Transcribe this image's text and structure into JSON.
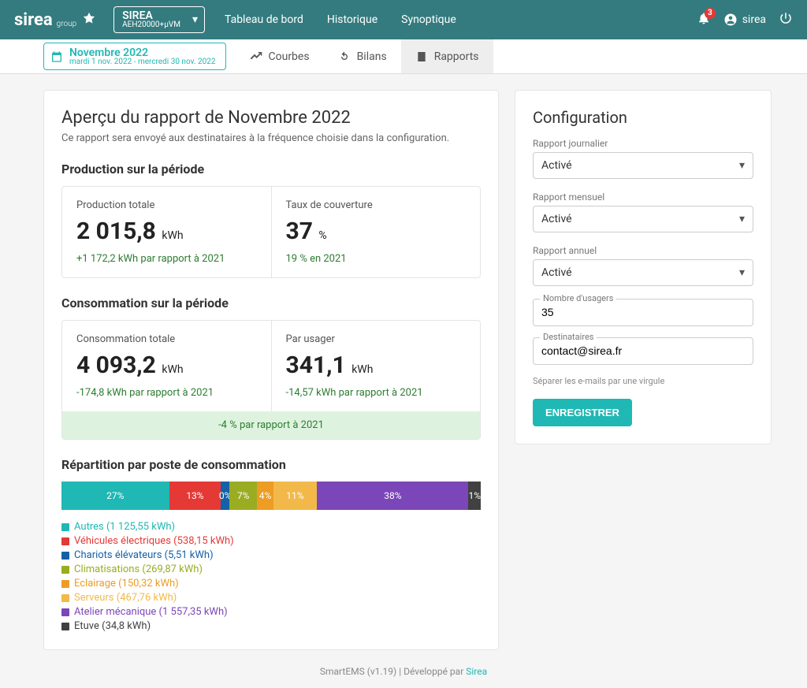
{
  "header": {
    "brand_main": "sirea",
    "brand_sub": "group",
    "site_name": "SIREA",
    "site_sub": "AEH20000+μVM",
    "nav": {
      "dashboard": "Tableau de bord",
      "history": "Historique",
      "synoptic": "Synoptique"
    },
    "notif_count": "3",
    "username": "sirea"
  },
  "secondary": {
    "date_title": "Novembre 2022",
    "date_range": "mardi 1 nov. 2022 - mercredi 30 nov. 2022",
    "tabs": {
      "curves": "Courbes",
      "balances": "Bilans",
      "reports": "Rapports"
    }
  },
  "report": {
    "title": "Aperçu du rapport de Novembre 2022",
    "subtitle": "Ce rapport sera envoyé aux destinataires à la fréquence choisie dans la configuration.",
    "prod_heading": "Production sur la période",
    "prod_total_label": "Production totale",
    "prod_total_value": "2 015,8",
    "prod_total_unit": "kWh",
    "prod_total_diff": "+1 172,2 kWh par rapport à 2021",
    "coverage_label": "Taux de couverture",
    "coverage_value": "37",
    "coverage_unit": "%",
    "coverage_diff": "19 % en 2021",
    "cons_heading": "Consommation sur la période",
    "cons_total_label": "Consommation totale",
    "cons_total_value": "4 093,2",
    "cons_total_unit": "kWh",
    "cons_total_diff": "-174,8 kWh par rapport à 2021",
    "per_user_label": "Par usager",
    "per_user_value": "341,1",
    "per_user_unit": "kWh",
    "per_user_diff": "-14,57 kWh par rapport à 2021",
    "overall_diff": "-4 % par rapport à 2021",
    "breakdown_heading": "Répartition par poste de consommation"
  },
  "chart_data": {
    "type": "bar",
    "orientation": "single-stacked-horizontal",
    "unit": "% of consumption",
    "categories": [
      "Autres",
      "Véhicules électriques",
      "Chariots élévateurs",
      "Climatisations",
      "Eclairage",
      "Serveurs",
      "Atelier mécanique",
      "Etuve"
    ],
    "values": [
      27,
      13,
      0,
      7,
      4,
      11,
      38,
      1
    ],
    "colors": [
      "#1fb8b4",
      "#e53935",
      "#1461a8",
      "#9aad22",
      "#ed9c24",
      "#f2b94a",
      "#7b46b8",
      "#414141"
    ],
    "legend_values_kwh": [
      "1 125,55",
      "538,15",
      "5,51",
      "269,87",
      "150,32",
      "467,76",
      "1 557,35",
      "34,8"
    ],
    "labels": {
      "autres": "Autres (1 125,55 kWh)",
      "vehicules": "Véhicules électriques (538,15 kWh)",
      "chariots": "Chariots élévateurs (5,51 kWh)",
      "clim": "Climatisations (269,87 kWh)",
      "eclairage": "Eclairage (150,32 kWh)",
      "serveurs": "Serveurs (467,76 kWh)",
      "atelier": "Atelier mécanique (1 557,35 kWh)",
      "etuve": "Etuve (34,8 kWh)"
    },
    "pct": {
      "autres": "27%",
      "vehicules": "13%",
      "chariots": "0%",
      "clim": "7%",
      "eclairage": "4%",
      "serveurs": "11%",
      "atelier": "38%",
      "etuve": "1%"
    }
  },
  "config": {
    "title": "Configuration",
    "daily_label": "Rapport journalier",
    "daily_value": "Activé",
    "monthly_label": "Rapport mensuel",
    "monthly_value": "Activé",
    "annual_label": "Rapport annuel",
    "annual_value": "Activé",
    "users_label": "Nombre d'usagers",
    "users_value": "35",
    "recipients_label": "Destinataires",
    "recipients_value": "contact@sirea.fr",
    "recipients_hint": "Séparer les e-mails par une virgule",
    "save": "ENREGISTRER"
  },
  "footer": {
    "text": "SmartEMS (v1.19) | Développé par ",
    "link": "Sirea"
  }
}
